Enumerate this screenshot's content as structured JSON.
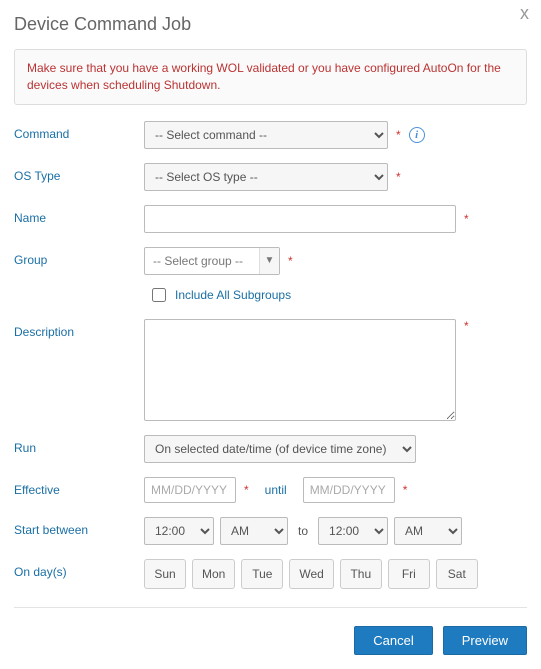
{
  "dialog": {
    "title": "Device Command Job",
    "close_label": "x",
    "warning": "Make sure that you have a working WOL validated or you have configured AutoOn for the devices when scheduling Shutdown."
  },
  "labels": {
    "command": "Command",
    "os_type": "OS Type",
    "name": "Name",
    "group": "Group",
    "include_subgroups": "Include All Subgroups",
    "description": "Description",
    "run": "Run",
    "effective": "Effective",
    "until": "until",
    "start_between": "Start between",
    "to": "to",
    "on_days": "On day(s)"
  },
  "placeholders": {
    "command": "-- Select command --",
    "os_type": "-- Select OS type --",
    "group": "-- Select group --",
    "date": "MM/DD/YYYY"
  },
  "values": {
    "run": "On selected date/time (of device time zone)",
    "time_start": "12:00",
    "ampm_start": "AM",
    "time_end": "12:00",
    "ampm_end": "AM"
  },
  "days": [
    "Sun",
    "Mon",
    "Tue",
    "Wed",
    "Thu",
    "Fri",
    "Sat"
  ],
  "footer": {
    "cancel": "Cancel",
    "preview": "Preview"
  }
}
